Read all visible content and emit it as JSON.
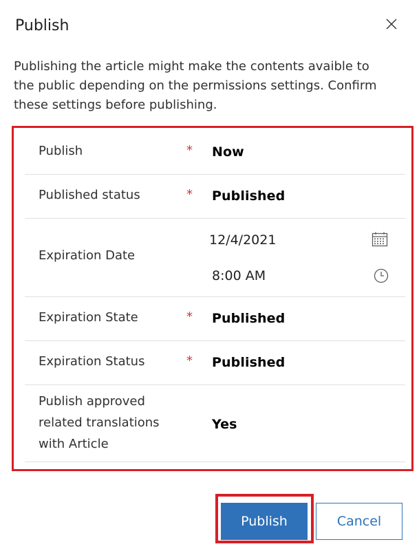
{
  "dialog": {
    "title": "Publish",
    "description": "Publishing the article might make the contents avaible to the public depending on the permissions settings. Confirm these settings before publishing."
  },
  "fields": {
    "publish": {
      "label": "Publish",
      "required_mark": "*",
      "value": "Now"
    },
    "published_status": {
      "label": "Published status",
      "required_mark": "*",
      "value": "Published"
    },
    "expiration_date": {
      "label": "Expiration Date",
      "date": "12/4/2021",
      "time": "8:00 AM"
    },
    "expiration_state": {
      "label": "Expiration State",
      "required_mark": "*",
      "value": "Published"
    },
    "expiration_status": {
      "label": "Expiration Status",
      "required_mark": "*",
      "value": "Published"
    },
    "publish_translations": {
      "label": "Publish approved related translations with Article",
      "value": "Yes"
    }
  },
  "footer": {
    "publish_label": "Publish",
    "cancel_label": "Cancel"
  },
  "icons": {
    "close": "close-icon",
    "calendar": "calendar-icon",
    "clock": "clock-icon"
  },
  "colors": {
    "primary": "#2f72b9",
    "highlight_outline": "#d81f26",
    "required": "#d13438",
    "divider": "#e1dfdd"
  }
}
